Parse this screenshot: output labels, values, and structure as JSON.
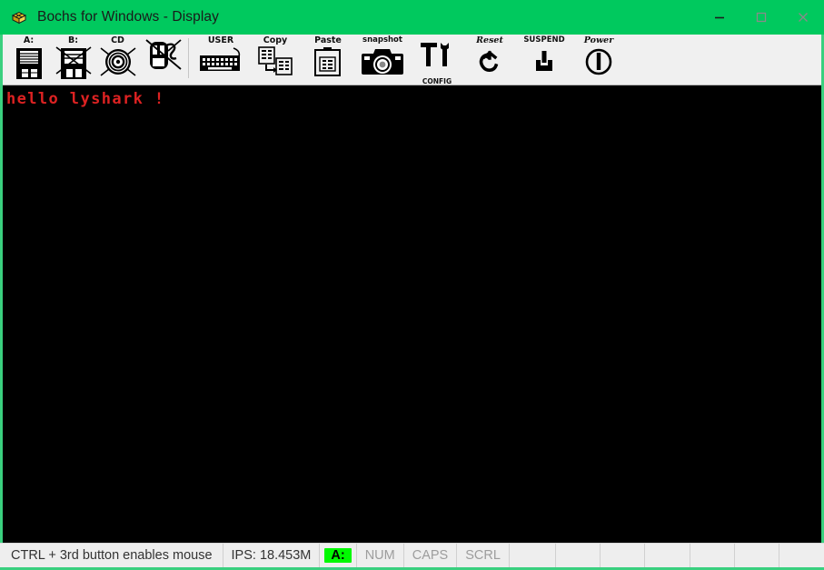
{
  "window": {
    "title": "Bochs for Windows - Display",
    "icon": "bochs-logo-icon",
    "titlebar_color": "#00c95e",
    "controls": [
      {
        "name": "minimize-button",
        "glyph": "minimize-icon"
      },
      {
        "name": "maximize-button",
        "glyph": "maximize-icon"
      },
      {
        "name": "close-button",
        "glyph": "close-icon"
      }
    ]
  },
  "toolbar": {
    "buttons": [
      {
        "label": "A:",
        "icon": "floppy-a-icon",
        "name": "toolbar-floppy-a"
      },
      {
        "label": "B:",
        "icon": "floppy-b-icon",
        "name": "toolbar-floppy-b"
      },
      {
        "label": "CD",
        "icon": "cdrom-icon",
        "name": "toolbar-cdrom"
      },
      {
        "label": "",
        "icon": "mouse-disabled-icon",
        "name": "toolbar-mouse"
      },
      {
        "label": "USER",
        "icon": "keyboard-icon",
        "name": "toolbar-user"
      },
      {
        "label": "Copy",
        "icon": "copy-icon",
        "name": "toolbar-copy"
      },
      {
        "label": "Paste",
        "icon": "paste-icon",
        "name": "toolbar-paste"
      },
      {
        "label": "snapshot",
        "icon": "camera-icon",
        "name": "toolbar-snapshot"
      },
      {
        "label": "CONFIG",
        "icon": "config-tools-icon",
        "name": "toolbar-config"
      },
      {
        "label": "Reset",
        "icon": "reset-arrow-icon",
        "name": "toolbar-reset"
      },
      {
        "label": "SUSPEND",
        "icon": "suspend-icon",
        "name": "toolbar-suspend"
      },
      {
        "label": "Power",
        "icon": "power-icon",
        "name": "toolbar-power"
      }
    ]
  },
  "display": {
    "background": "#000000",
    "text_color": "#dd2222",
    "lines": [
      "hello lyshark !"
    ]
  },
  "statusbar": {
    "message": "CTRL + 3rd button enables mouse",
    "ips": "IPS: 18.453M",
    "floppy_indicator": "A:",
    "floppy_active_color": "#00f900",
    "leds": [
      "NUM",
      "CAPS",
      "SCRL"
    ],
    "empty_cells": 7
  }
}
